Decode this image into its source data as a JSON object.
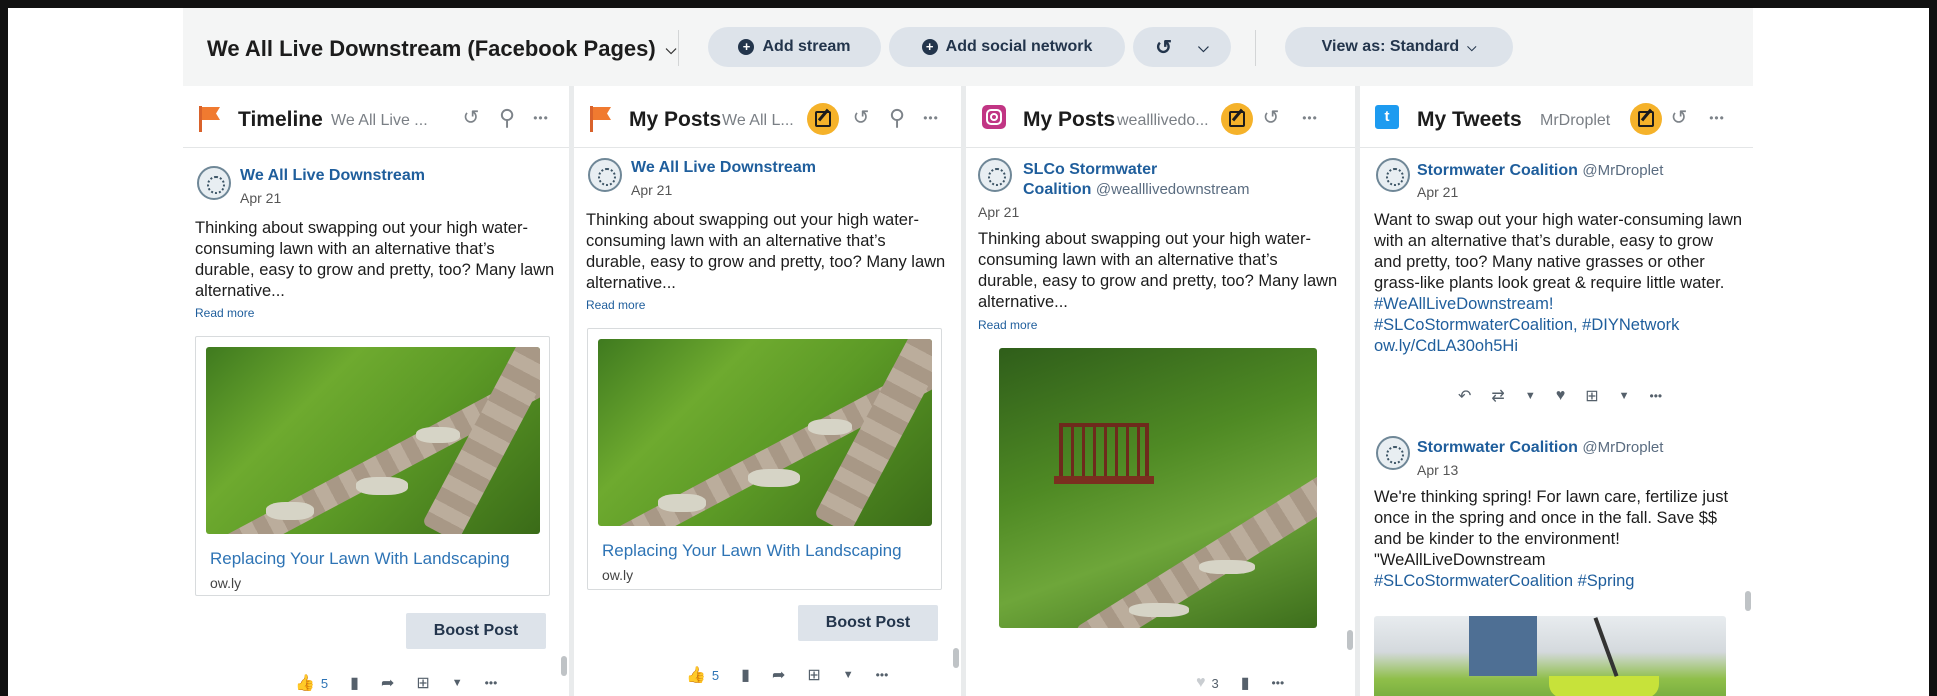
{
  "toolbar": {
    "title": "We All Live Downstream (Facebook Pages)",
    "add_stream": "Add stream",
    "add_network": "Add social network",
    "view_as": "View as: Standard"
  },
  "columns": [
    {
      "title": "Timeline",
      "subtitle": "We All Live ...",
      "post": {
        "author": "We All Live Downstream",
        "date": "Apr 21",
        "text": "Thinking about swapping out your high water-consuming lawn with an alternative that’s durable, easy to grow and pretty, too? Many lawn alternative...",
        "read_more": "Read more",
        "link_title": "Replacing Your Lawn With Landscaping",
        "link_domain": "ow.ly",
        "boost": "Boost Post",
        "likes": "5"
      }
    },
    {
      "title": "My Posts",
      "subtitle": "We All L...",
      "post": {
        "author": "We All Live Downstream",
        "date": "Apr 21",
        "text": "Thinking about swapping out your high water-consuming lawn with an alternative that’s durable, easy to grow and pretty, too? Many lawn alternative...",
        "read_more": "Read more",
        "link_title": "Replacing Your Lawn With Landscaping",
        "link_domain": "ow.ly",
        "boost": "Boost Post",
        "likes": "5"
      }
    },
    {
      "title": "My Posts",
      "subtitle": "wealllivedo...",
      "post": {
        "author_line1": "SLCo Stormwater",
        "author_line2": "Coalition",
        "handle": "@wealllivedownstream",
        "date": "Apr 21",
        "text": "Thinking about swapping out your high water-consuming lawn with an alternative that’s durable, easy to grow and pretty, too? Many lawn alternative...",
        "read_more": "Read more",
        "likes": "3"
      }
    },
    {
      "title": "My Tweets",
      "subtitle": "MrDroplet",
      "tweets": [
        {
          "author": "Stormwater Coalition",
          "handle": "@MrDroplet",
          "date": "Apr 21",
          "text": "Want to swap out your high water-consuming lawn with an alternative that’s durable, easy to grow and pretty, too? Many native grasses or other grass-like plants look great & require little water.",
          "tags": "#WeAllLiveDownstream! #SLCoStormwaterCoalition, #DIYNetwork ow.ly/CdLA30oh5Hi"
        },
        {
          "author": "Stormwater Coalition",
          "handle": "@MrDroplet",
          "date": "Apr 13",
          "text": "We're thinking spring!  For lawn care, fertilize just once in the spring and once in the fall. Save $$ and be kinder to the environment! \"WeAllLiveDownstream",
          "tags": "#SLCoStormwaterCoalition #Spring"
        }
      ]
    }
  ],
  "icons": {
    "refresh": "↺",
    "search": "⚲",
    "more": "•••",
    "chevron": "⌄"
  },
  "colors": {
    "accent": "#f5b22a",
    "link": "#1f5e9c",
    "pill_bg": "#dde3ea"
  }
}
